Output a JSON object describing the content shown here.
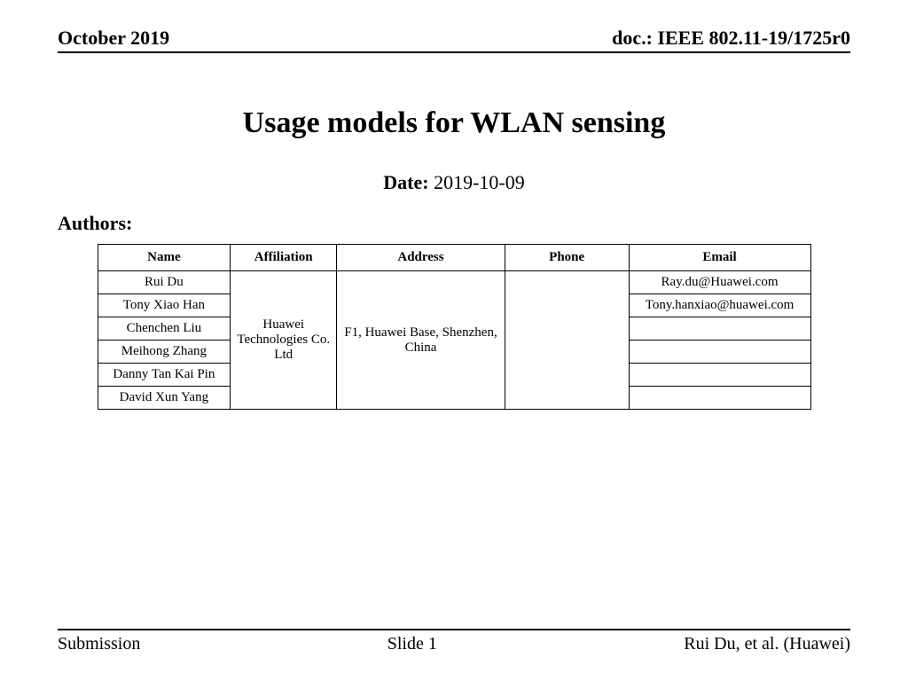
{
  "header": {
    "left": "October 2019",
    "right": "doc.: IEEE 802.11-19/1725r0"
  },
  "title": "Usage models for WLAN sensing",
  "date": {
    "label": "Date:",
    "value": "2019-10-09"
  },
  "authors_label": "Authors:",
  "table": {
    "headers": {
      "name": "Name",
      "affiliation": "Affiliation",
      "address": "Address",
      "phone": "Phone",
      "email": "Email"
    },
    "affiliation": "Huawei Technologies Co. Ltd",
    "address": "F1, Huawei Base, Shenzhen, China",
    "rows": [
      {
        "name": "Rui Du",
        "email": "Ray.du@Huawei.com"
      },
      {
        "name": "Tony Xiao Han",
        "email": "Tony.hanxiao@huawei.com"
      },
      {
        "name": "Chenchen Liu",
        "email": ""
      },
      {
        "name": "Meihong Zhang",
        "email": ""
      },
      {
        "name": "Danny Tan Kai Pin",
        "email": ""
      },
      {
        "name": "David Xun Yang",
        "email": ""
      }
    ]
  },
  "footer": {
    "left": "Submission",
    "center": "Slide 1",
    "right": "Rui Du, et al. (Huawei)"
  }
}
